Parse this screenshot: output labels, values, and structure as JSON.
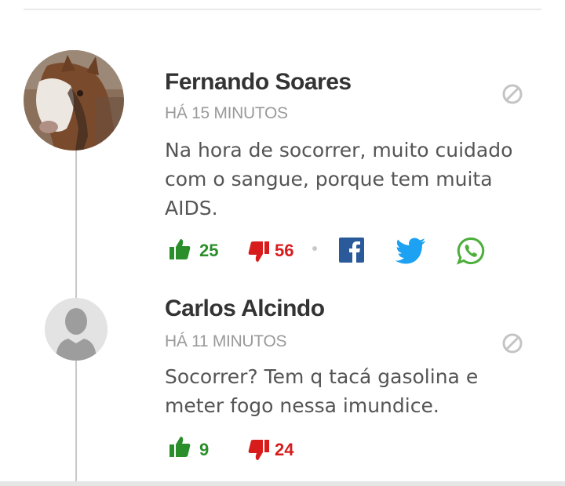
{
  "comments": [
    {
      "author": "Fernando Soares",
      "time": "HÁ 15 MINUTOS",
      "text": "Na hora de socorrer, muito cuidado com o sangue, porque tem muita AIDS.",
      "likes": "25",
      "dislikes": "56",
      "avatar": "horse-photo-avatar",
      "share": [
        "facebook-icon",
        "twitter-icon",
        "whatsapp-icon"
      ]
    },
    {
      "author": "Carlos Alcindo",
      "time": "HÁ 11 MINUTOS",
      "text": "Socorrer? Tem q tacá gasolina e meter fogo nessa imundice.",
      "likes": "9",
      "dislikes": "24",
      "avatar": "default-user-avatar"
    }
  ],
  "colors": {
    "like": "#2a8f2a",
    "dislike": "#d81c1c",
    "facebook": "#2a5a99",
    "twitter": "#1da1f2",
    "whatsapp": "#4caf3a",
    "muted": "#9a9a9a"
  }
}
